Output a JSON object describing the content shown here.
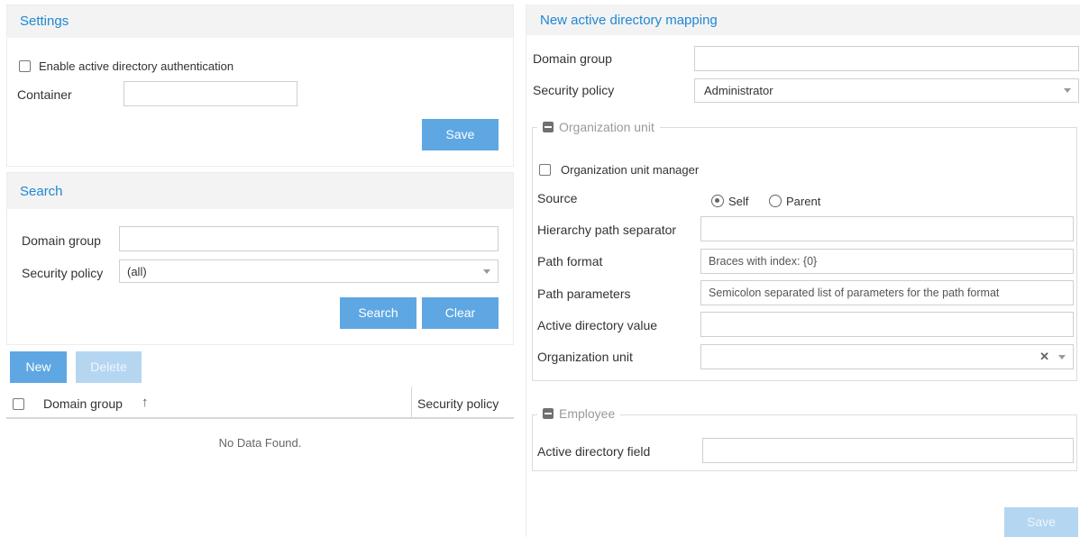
{
  "settings": {
    "title": "Settings",
    "enable_ad_label": "Enable active directory authentication",
    "container_label": "Container",
    "container_value": "",
    "save_label": "Save"
  },
  "search": {
    "title": "Search",
    "domain_group_label": "Domain group",
    "domain_group_value": "",
    "security_policy_label": "Security policy",
    "security_policy_value": "(all)",
    "search_label": "Search",
    "clear_label": "Clear"
  },
  "grid": {
    "new_label": "New",
    "delete_label": "Delete",
    "columns": [
      "Domain group",
      "Security policy"
    ],
    "sort_icon": "arrow-up-icon",
    "empty_text": "No Data Found."
  },
  "mapping": {
    "title": "New active directory mapping",
    "domain_group_label": "Domain group",
    "domain_group_value": "",
    "security_policy_label": "Security policy",
    "security_policy_value": "Administrator",
    "org_unit_section": {
      "legend": "Organization unit",
      "manager_label": "Organization unit manager",
      "source_label": "Source",
      "source_options": [
        "Self",
        "Parent"
      ],
      "source_selected": "Self",
      "hierarchy_label": "Hierarchy path separator",
      "hierarchy_value": "",
      "path_format_label": "Path format",
      "path_format_placeholder": "Braces with index: {0}",
      "path_params_label": "Path parameters",
      "path_params_placeholder": "Semicolon separated list of parameters for the path format",
      "ad_value_label": "Active directory value",
      "ad_value_value": "",
      "org_unit_label": "Organization unit",
      "org_unit_value": ""
    },
    "employee_section": {
      "legend": "Employee",
      "ad_field_label": "Active directory field",
      "ad_field_value": ""
    },
    "save_label": "Save"
  },
  "colors": {
    "accent": "#1e88d4",
    "button": "#5ea7e3",
    "button_disabled": "#b5d6f1",
    "header_bg": "#f3f3f3"
  }
}
